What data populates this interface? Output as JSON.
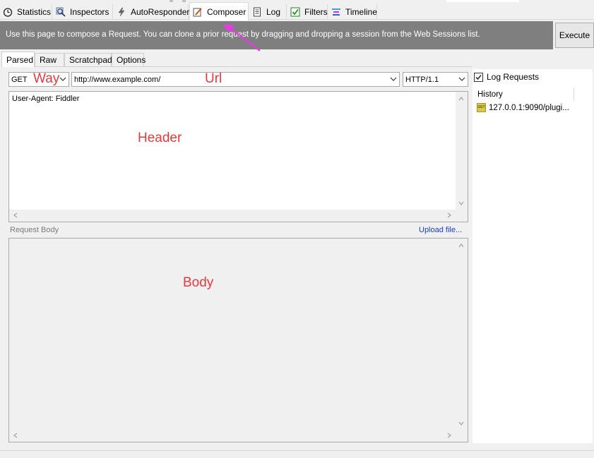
{
  "top_tabs": [
    {
      "label": "Statistics",
      "icon": "stopwatch-icon"
    },
    {
      "label": "Inspectors",
      "icon": "magnifier-icon"
    },
    {
      "label": "AutoResponder",
      "icon": "lightning-icon"
    },
    {
      "label": "Composer",
      "icon": "pencil-icon",
      "active": true
    },
    {
      "label": "Log",
      "icon": "document-icon"
    },
    {
      "label": "Filters",
      "icon": "checkbox-icon"
    },
    {
      "label": "Timeline",
      "icon": "timeline-icon"
    }
  ],
  "banner": {
    "text": "Use this page to compose a Request. You can clone a prior request by dragging and dropping a session from the Web Sessions list.",
    "execute_label": "Execute",
    "arrow_color": "#e83ae8"
  },
  "sub_tabs": [
    "Parsed",
    "Raw",
    "Scratchpad",
    "Options"
  ],
  "request_line": {
    "method": "GET",
    "url": "http://www.example.com/",
    "version": "HTTP/1.1"
  },
  "headers_text": "User-Agent: Fiddler",
  "request_body_label": "Request Body",
  "upload_link": "Upload file...",
  "annotations": {
    "way": "Way",
    "url": "Url",
    "header": "Header",
    "body": "Body",
    "color": "#e8383d"
  },
  "right_panel": {
    "log_requests_label": "Log Requests",
    "log_requests_checked": true,
    "history_header": "History",
    "history_items": [
      {
        "label": "127.0.0.1:9090/plugi...",
        "icon": "get-request-icon",
        "icon_text": "GET"
      }
    ]
  }
}
